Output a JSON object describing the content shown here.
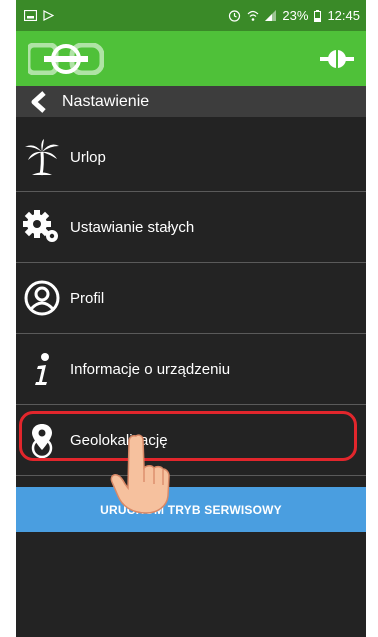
{
  "status_bar": {
    "left_icons": [
      "screenshot-icon",
      "play-icon"
    ],
    "right_icons": [
      "alarm-icon",
      "wifi-icon",
      "signal-icon",
      "battery-icon"
    ],
    "battery": "23%",
    "time": "12:45"
  },
  "header": {
    "logo_text": "EOB",
    "logo_icon": "eob-logo",
    "connection_icon": "plug-icon"
  },
  "nav": {
    "back_icon": "chevron-left-icon",
    "title": "Nastawienie"
  },
  "menu": {
    "items": [
      {
        "label": "Urlop",
        "icon": "palm-tree-icon"
      },
      {
        "label": "Ustawianie stałych",
        "icon": "gears-icon"
      },
      {
        "label": "Profil",
        "icon": "user-circle-icon"
      },
      {
        "label": "Informacje o urządzeniu",
        "icon": "info-icon"
      },
      {
        "label": "Geolokalizację",
        "icon": "location-pin-icon"
      }
    ]
  },
  "service_button": {
    "label": "URUCHOM TRYB SERWISOWY"
  },
  "colors": {
    "status_bar": "#3a8a28",
    "header": "#4fc139",
    "background": "#232323",
    "back_bar": "#3d3d3d",
    "service_button": "#4a9ee0",
    "highlight": "#e2262c"
  }
}
